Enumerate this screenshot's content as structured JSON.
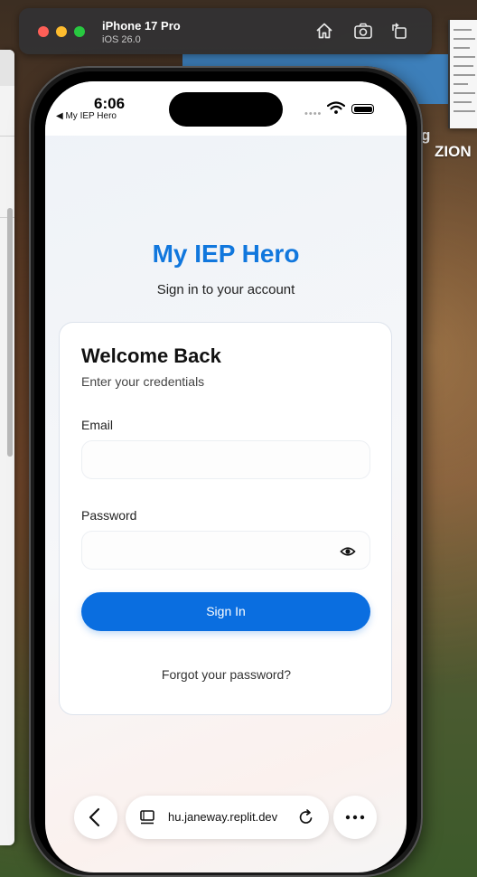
{
  "simulator": {
    "device_name": "iPhone 17 Pro",
    "os_version": "iOS 26.0",
    "home_icon": "home-icon",
    "screenshot_icon": "camera-icon",
    "rotate_icon": "rotate-icon"
  },
  "desktop": {
    "label_g": "g",
    "label_zion": "ZION"
  },
  "status_bar": {
    "time": "6:06",
    "back_app": "◀ My IEP Hero"
  },
  "app": {
    "title": "My IEP Hero",
    "subtitle": "Sign in to your account",
    "accent_color": "#1177dd"
  },
  "login_card": {
    "title": "Welcome Back",
    "subtitle": "Enter your credentials",
    "email_label": "Email",
    "email_value": "",
    "password_label": "Password",
    "password_value": "",
    "sign_in_label": "Sign In",
    "forgot_label": "Forgot your password?",
    "button_color": "#0a6ee0"
  },
  "browser_bar": {
    "url": "hu.janeway.replit.dev",
    "back_icon": "chevron-left-icon",
    "tabs_icon": "tabs-icon",
    "reload_icon": "reload-icon",
    "more_icon": "more-icon"
  }
}
